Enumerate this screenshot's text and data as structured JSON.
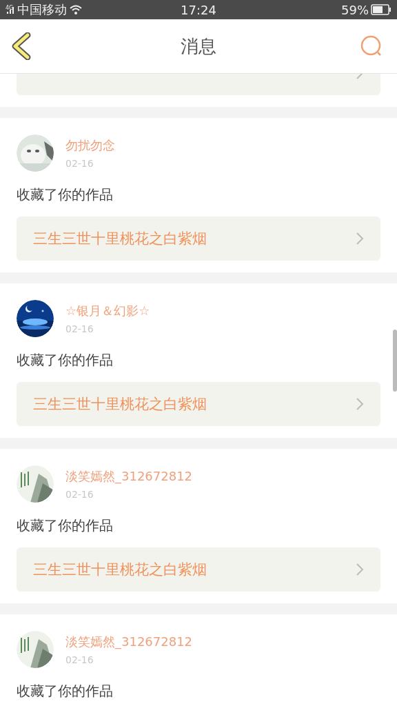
{
  "status_bar": {
    "network": "4G",
    "carrier": "中国移动",
    "time": "17:24",
    "battery": "59%"
  },
  "header": {
    "title": "消息"
  },
  "messages": [
    {
      "user": "勿扰勿念",
      "date": "02-16",
      "action": "收藏了你的作品",
      "work": "三生三世十里桃花之白紫烟"
    },
    {
      "user": "☆银月＆幻影☆",
      "date": "02-16",
      "action": "收藏了你的作品",
      "work": "三生三世十里桃花之白紫烟"
    },
    {
      "user": "淡笑嫣然_312672812",
      "date": "02-16",
      "action": "收藏了你的作品",
      "work": "三生三世十里桃花之白紫烟"
    },
    {
      "user": "淡笑嫣然_312672812",
      "date": "02-16",
      "action": "收藏了你的作品"
    }
  ]
}
